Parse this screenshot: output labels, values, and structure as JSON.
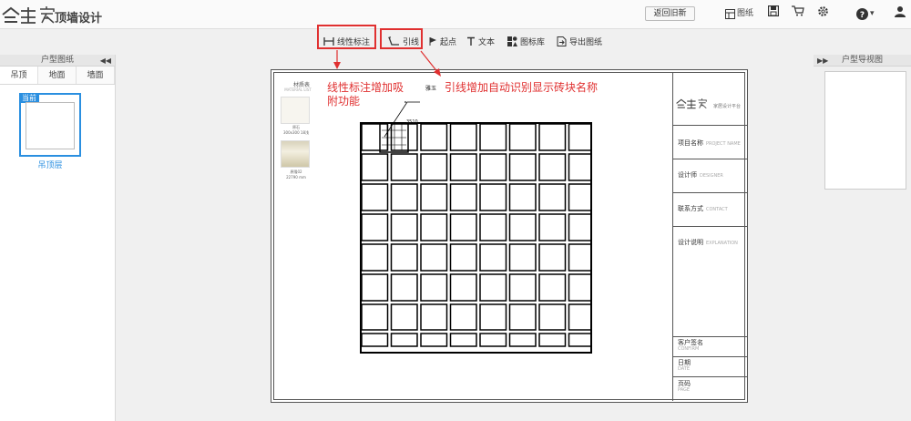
{
  "app": {
    "title": "顶墙设计"
  },
  "header": {
    "back_label": "返回旧新",
    "drawings_label": "图纸",
    "help_caret": "▾"
  },
  "toolbar": {
    "linear_label": "线性标注",
    "leader_label": "引线",
    "start_label": "起点",
    "text_label": "文本",
    "library_label": "图标库",
    "export_label": "导出图纸"
  },
  "left_panel": {
    "title": "户型图纸",
    "collapse": "◀◀",
    "tabs": [
      "吊顶",
      "地面",
      "墙面"
    ],
    "thumb_badge": "当前",
    "thumb_label": "吊顶层"
  },
  "right_panel": {
    "title": "户型导视图",
    "collapse": "▶▶"
  },
  "sheet": {
    "materials": {
      "title": "材质表",
      "subtitle": "MATERIAL LIST",
      "items": [
        {
          "name": "原石",
          "size": "300x300 18浅"
        },
        {
          "name": "原隆02",
          "size": "22790 mm"
        }
      ]
    },
    "leader_text": "雅玉",
    "dim_text": "3510",
    "titleblock": {
      "brand": "家居设计平台",
      "project": {
        "cn": "项目名称",
        "en": "PROJECT NAME"
      },
      "designer": {
        "cn": "设计师",
        "en": "DESIGNER"
      },
      "contact": {
        "cn": "联系方式",
        "en": "CONTACT"
      },
      "explanation": {
        "cn": "设计说明",
        "en": "EXPLANATION"
      },
      "customer": {
        "cn": "客户签名",
        "en": "CONFIRM"
      },
      "date": {
        "cn": "日期",
        "en": "DATE"
      },
      "page": {
        "cn": "页码",
        "en": "PAGE"
      }
    }
  },
  "annotations": {
    "linear_note": "线性标注增加吸附功能",
    "leader_note": "引线增加自动识别显示砖块名称"
  },
  "colors": {
    "accent": "#2a8fe0",
    "annotation": "#e03030"
  }
}
